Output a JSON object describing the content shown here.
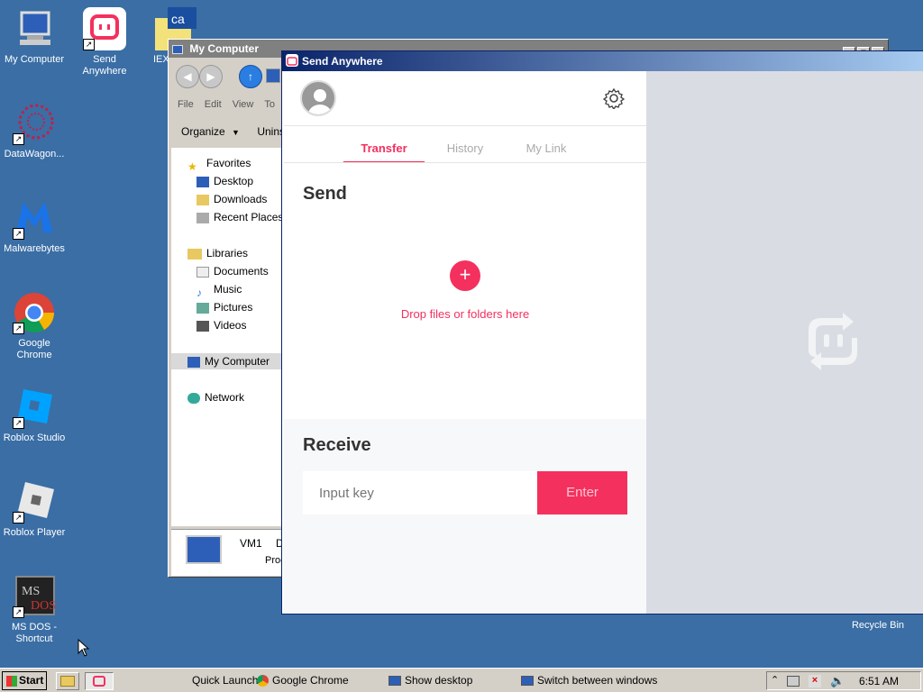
{
  "desktop": {
    "icons": [
      {
        "label": "My Computer"
      },
      {
        "label": "Send Anywhere"
      },
      {
        "label": "IEX"
      },
      {
        "label": "DataWagon..."
      },
      {
        "label": "Malwarebytes"
      },
      {
        "label": "Google Chrome"
      },
      {
        "label": "Roblox Studio"
      },
      {
        "label": "Roblox Player"
      },
      {
        "label": "MS DOS - Shortcut"
      },
      {
        "label": "Recycle Bin"
      }
    ]
  },
  "explorer": {
    "title": "My Computer",
    "menu": [
      "File",
      "Edit",
      "View",
      "To"
    ],
    "toolbar": {
      "organize": "Organize",
      "uninstall": "Uninsta"
    },
    "nav": {
      "favorites": "Favorites",
      "desktop": "Desktop",
      "downloads": "Downloads",
      "recent": "Recent Places",
      "libraries": "Libraries",
      "documents": "Documents",
      "music": "Music",
      "pictures": "Pictures",
      "videos": "Videos",
      "mycomputer": "My Computer",
      "network": "Network"
    },
    "details": {
      "name": "VM1",
      "d": "D",
      "proc": "Proc"
    }
  },
  "send_anywhere": {
    "title": "Send Anywhere",
    "tabs": {
      "transfer": "Transfer",
      "history": "History",
      "mylink": "My Link"
    },
    "send_heading": "Send",
    "add_symbol": "+",
    "drop_text": "Drop files or folders here",
    "receive_heading": "Receive",
    "input_placeholder": "Input key",
    "enter_label": "Enter",
    "accent": "#f4305e"
  },
  "taskbar": {
    "start": "Start",
    "quick_launch": "Quick Launch",
    "chrome": "Google Chrome",
    "show_desktop": "Show desktop",
    "switch_windows": "Switch between windows",
    "clock": "6:51 AM"
  }
}
